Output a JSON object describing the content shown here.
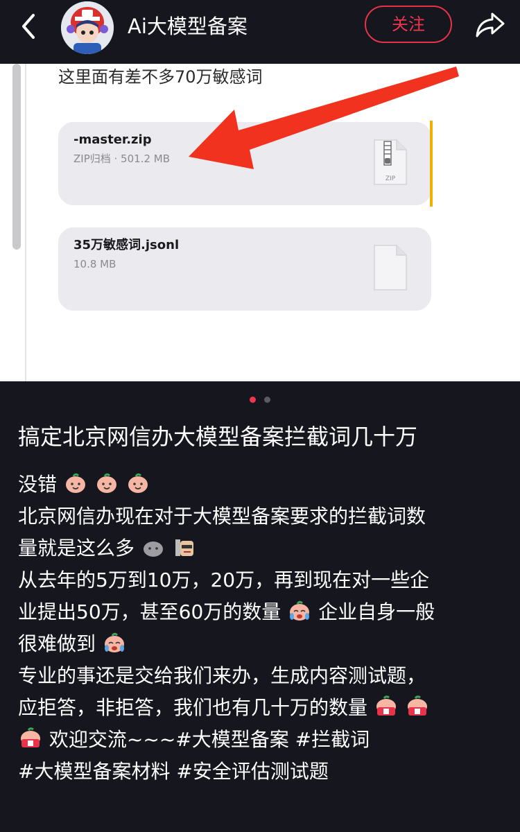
{
  "header": {
    "author_name": "Ai大模型备案",
    "follow_label": "关注"
  },
  "screenshot": {
    "caption": "这里面有差不多70万敏感词",
    "files": [
      {
        "name": "-master.zip",
        "meta": "ZIP归档 · 501.2 MB",
        "icon": "zip-file-icon",
        "icon_label": "ZIP"
      },
      {
        "name": "35万敏感词.jsonl",
        "meta": "10.8 MB",
        "icon": "document-file-icon"
      }
    ],
    "arrow_color": "#f0321e"
  },
  "pager": {
    "count": 2,
    "active": 0
  },
  "post": {
    "title": "搞定北京网信办大模型备案拦截词几十万",
    "lines": {
      "l1": "没错",
      "l2": "北京网信办现在对于大模型备案要求的拦截词数",
      "l3": "量就是这么多",
      "l4": "从去年的5万到10万，20万，再到现在对一些企",
      "l5a": "业提出50万，甚至60万的数量",
      "l5b": "企业自身一般",
      "l6": "很难做到",
      "l7": "专业的事还是交给我们来办，生成内容测试题，",
      "l8": "应拒答，非拒答，我们也有几十万的数量",
      "l9": "欢迎交流~~~"
    },
    "tags": [
      "#大模型备案",
      "#拦截词",
      "#大模型备案材料",
      "#安全评估测试题"
    ]
  },
  "colors": {
    "accent": "#f0364f",
    "background": "#15161e"
  }
}
